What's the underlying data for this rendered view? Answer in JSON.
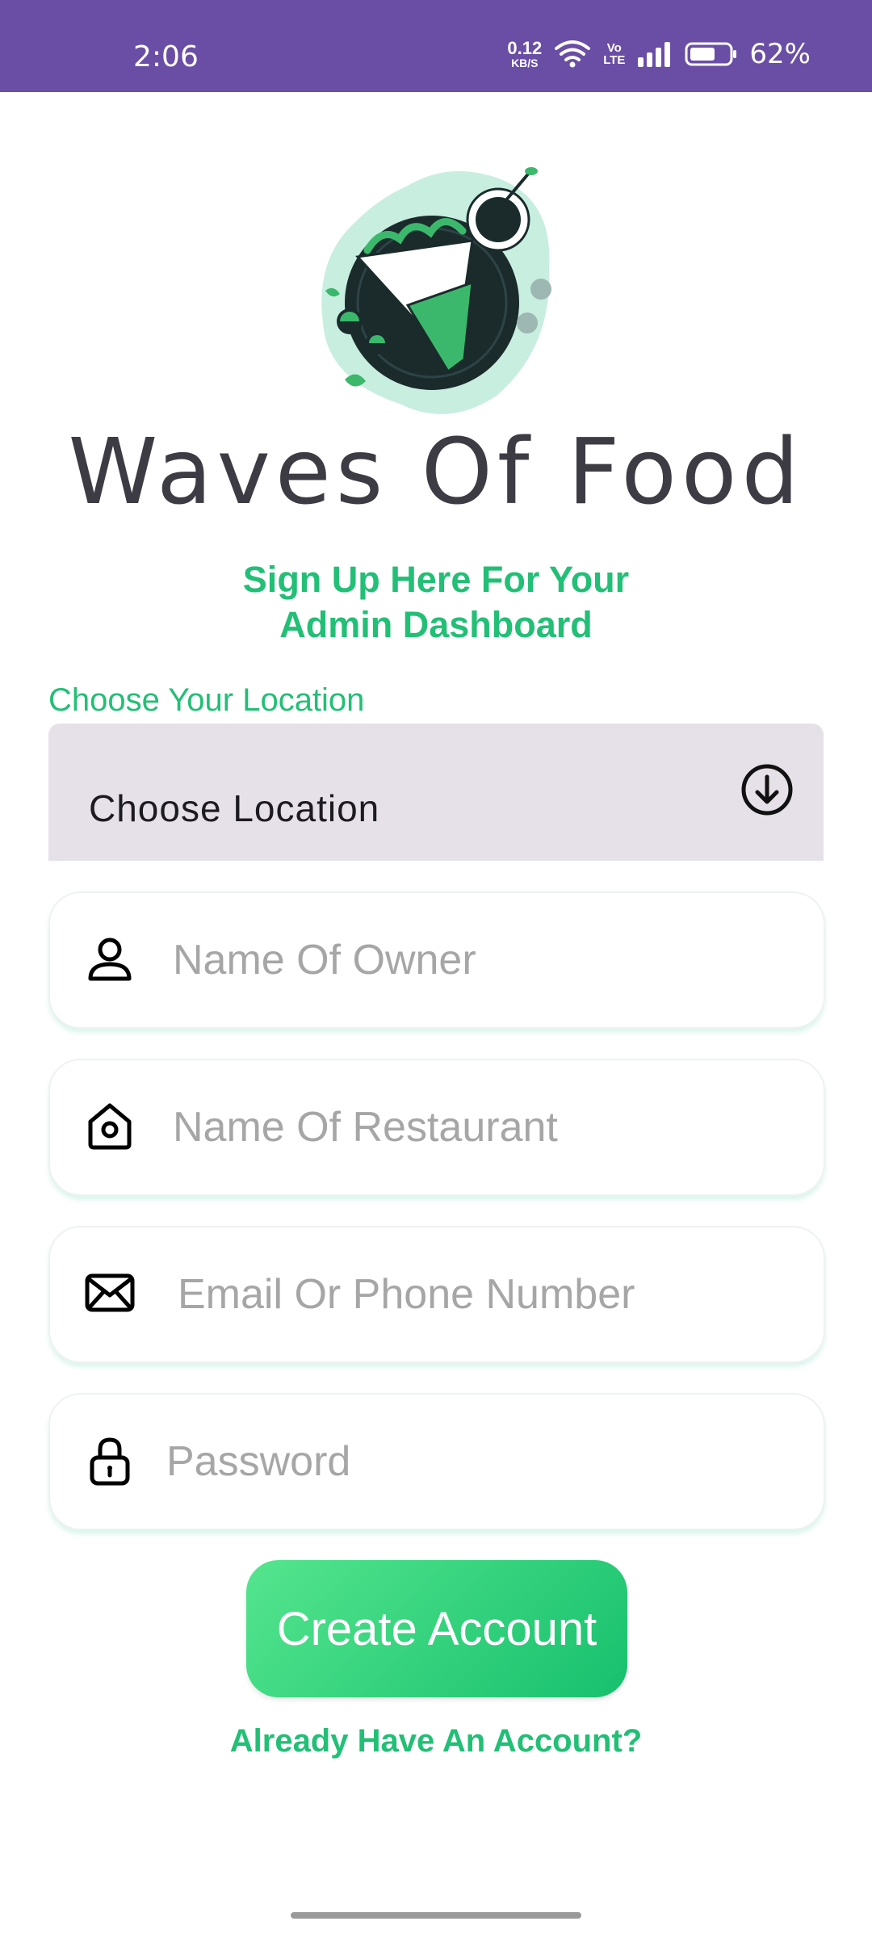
{
  "status_bar": {
    "time": "2:06",
    "net_speed_value": "0.12",
    "net_speed_unit": "KB/S",
    "volte_top": "Vo",
    "volte_bottom": "LTE",
    "battery_pct": "62%",
    "icons": [
      "wifi-icon",
      "signal-icon",
      "battery-icon"
    ]
  },
  "app": {
    "title": "Waves Of Food",
    "subtitle_line1": "Sign Up Here For Your",
    "subtitle_line2": "Admin Dashboard",
    "logo": "food-wrap-illustration"
  },
  "location": {
    "label": "Choose Your Location",
    "selected": "Choose Location",
    "icon": "arrow-down-circle-icon"
  },
  "form": {
    "owner_placeholder": "Name Of Owner",
    "restaurant_placeholder": "Name Of Restaurant",
    "email_placeholder": "Email Or Phone Number",
    "password_placeholder": "Password"
  },
  "actions": {
    "create_account": "Create Account",
    "already_have_account": "Already Have An Account?"
  },
  "colors": {
    "status_bar": "#6a4ea5",
    "accent_green": "#22bf76",
    "button_gradient_start": "#55e58e",
    "button_gradient_end": "#17c06e",
    "title_dark": "#3d3b44",
    "select_bg": "#e6e1e8"
  }
}
